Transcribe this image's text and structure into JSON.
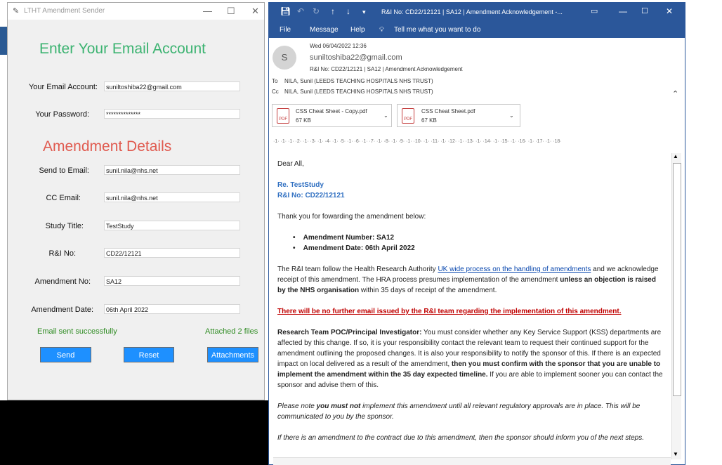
{
  "tk": {
    "title": "LTHT Amendment Sender",
    "heading_email": "Enter Your Email Account",
    "heading_amend": "Amendment Details",
    "labels": {
      "email": "Your Email Account:",
      "password": "Your Password:",
      "send_to": "Send to Email:",
      "cc": "CC Email:",
      "study": "Study Title:",
      "rni": "R&I No:",
      "amend_no": "Amendment No:",
      "amend_date": "Amendment Date:"
    },
    "values": {
      "email": "suniltoshiba22@gmail.com",
      "password": "**************",
      "send_to": "sunil.nila@nhs.net",
      "cc": "sunil.nila@nhs.net",
      "study": "TestStudy",
      "rni": "CD22/12121",
      "amend_no": "SA12",
      "amend_date": "06th April 2022"
    },
    "status_sent": "Email sent successfully",
    "status_files": "Attached 2 files",
    "btn_send": "Send",
    "btn_reset": "Reset",
    "btn_attach": "Attachments",
    "controls": {
      "min": "—",
      "max": "☐",
      "close": "✕"
    }
  },
  "outlook": {
    "subject_title": "R&I No: CD22/12121 | SA12 | Amendment Acknowledgement -...",
    "menu": [
      "File",
      "Message",
      "Help"
    ],
    "tell_me": "Tell me what you want to do",
    "date": "Wed 06/04/2022 12:36",
    "avatar": "S",
    "from": "suniltoshiba22@gmail.com",
    "subject": "R&I No: CD22/12121 | SA12 | Amendment Acknowledgement",
    "to_label": "To",
    "to": "NILA, Sunil (LEEDS TEACHING HOSPITALS NHS TRUST)",
    "cc_label": "Cc",
    "cc": "NILA, Sunil (LEEDS TEACHING HOSPITALS NHS TRUST)",
    "attachments": [
      {
        "name": "CSS Cheat Sheet - Copy.pdf",
        "size": "67 KB"
      },
      {
        "name": "CSS Cheat Sheet.pdf",
        "size": "67 KB"
      }
    ],
    "ruler": "·1· ·1· ·1· ·2· ·1· ·3· ·1· ·4· ·1· ·5· ·1· ·6· ·1· ·7· ·1· ·8· ·1· ·9· ·1· ·10· ·1· ·11· ·1· ·12· ·1· ·13· ·1· ·14· ·1· ·15· ·1· ·16· ·1· ·17· ·1· ·18·",
    "body": {
      "greeting": "Dear All,",
      "re_study": "Re. TestStudy",
      "re_rni": "R&I No: CD22/12121",
      "thanks": "Thank you for fowarding the amendment below:",
      "bullet1": "Amendment Number: SA12",
      "bullet2": "Amendment Date: 06th April 2022",
      "p1_a": "The R&I team follow the Health Research Authority ",
      "p1_link": "UK wide process on the handling of amendments",
      "p1_b": " and we acknowledge receipt of this amendment. The HRA process presumes implementation of the amendment ",
      "p1_bold": "unless an objection is raised by the NHS organisation",
      "p1_c": " within 35 days of receipt of the amendment.",
      "warning": "There will be no further email issued by the R&I team regarding the implementation of this amendment.",
      "p2_bold1": "Research Team POC/Principal Investigator:",
      "p2_a": " You must consider whether any Key Service Support (KSS) departments are affected by this change. If so, it is your responsibility contact the relevant team to request their continued support for the amendment outlining the proposed changes. It is also your responsibility to notify the sponsor of this. If there is an expected impact on local delivered as a result of the amendment, ",
      "p2_bold2": "then you must confirm with the sponsor that you are unable to implement the amendment within the 35 day expected timeline.",
      "p2_b": " If you are able to implement sooner you can contact the sponsor and advise them of this.",
      "p3_a": "Please note ",
      "p3_bold": "you must not",
      "p3_b": " implement this amendment until all relevant regulatory approvals are in place. This will be communicated to you by the sponsor.",
      "p4": "If there is an amendment to the contract due to this amendment, then the sponsor should inform you of the next steps."
    }
  }
}
